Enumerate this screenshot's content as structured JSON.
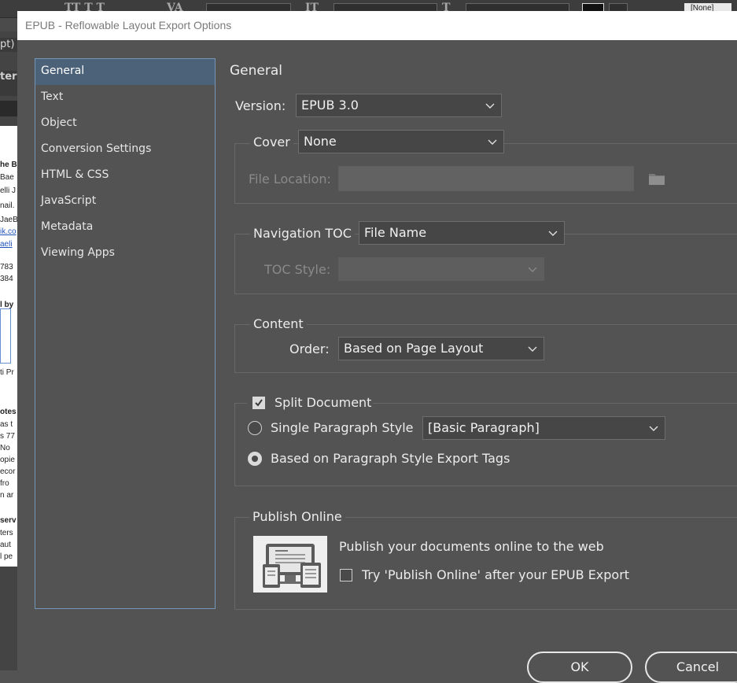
{
  "background_app": {
    "toolbar_style_field": "[None]",
    "panel_label": "pt)",
    "panel_tab_label": "teri",
    "document_fragments": [
      "he B",
      "Bae",
      "elli J",
      "nail.",
      "JaeB",
      "ik.co",
      "aeli",
      "783",
      "384",
      "l by",
      "ti Pr",
      "otes",
      "as t",
      "s 77",
      "No",
      "opie",
      "ecor",
      "fro",
      "n ar",
      "serv",
      "ters",
      "aut",
      "l pe"
    ]
  },
  "dialog": {
    "title": "EPUB - Reflowable Layout Export Options",
    "nav": {
      "selected_index": 0,
      "items": [
        {
          "label": "General"
        },
        {
          "label": "Text"
        },
        {
          "label": "Object"
        },
        {
          "label": "Conversion Settings"
        },
        {
          "label": "HTML & CSS"
        },
        {
          "label": "JavaScript"
        },
        {
          "label": "Metadata"
        },
        {
          "label": "Viewing Apps"
        }
      ]
    },
    "panel_title": "General",
    "version": {
      "label": "Version:",
      "value": "EPUB 3.0"
    },
    "cover": {
      "label": "Cover",
      "value": "None",
      "file_location_label": "File Location:",
      "file_location_value": "",
      "folder_icon": "folder-icon"
    },
    "navigation_toc": {
      "label": "Navigation TOC",
      "value": "File Name",
      "toc_style_label": "TOC Style:",
      "toc_style_value": ""
    },
    "content": {
      "title": "Content",
      "order_label": "Order:",
      "order_value": "Based on Page Layout"
    },
    "split": {
      "split_document_label": "Split Document",
      "split_document_checked": true,
      "single_paragraph_label": "Single Paragraph Style",
      "single_paragraph_value": "[Basic Paragraph]",
      "single_paragraph_selected": false,
      "export_tags_label": "Based on Paragraph Style Export Tags",
      "export_tags_selected": true
    },
    "publish_online": {
      "title": "Publish Online",
      "description": "Publish your documents online to the web",
      "try_label": "Try 'Publish Online' after your EPUB Export",
      "try_checked": false,
      "thumbnail_icon": "publish-devices-icon"
    },
    "buttons": {
      "ok": "OK",
      "cancel": "Cancel"
    },
    "colors": {
      "dialog_bg": "#535353",
      "nav_selected": "#4c6278",
      "nav_border": "#7494b8",
      "text": "#ececec",
      "text_disabled": "#8a8a8a"
    }
  }
}
